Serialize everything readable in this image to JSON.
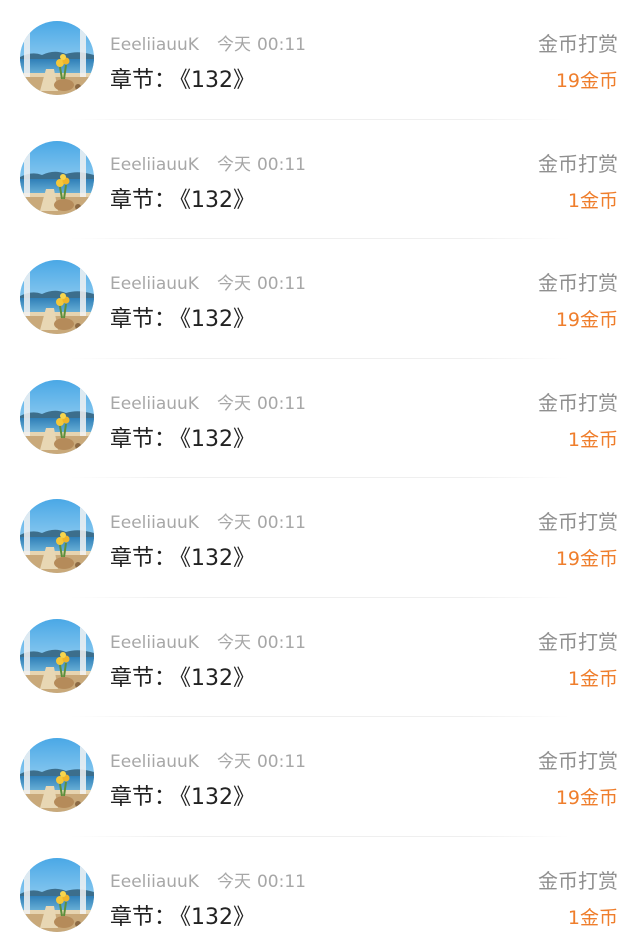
{
  "rewards": [
    {
      "user": "EeeliiauuK",
      "day": "今天",
      "time": "00:11",
      "chapter_label": "章节：",
      "chapter_title": "《132》",
      "reward_label": "金币打赏",
      "amount": "19金币"
    },
    {
      "user": "EeeliiauuK",
      "day": "今天",
      "time": "00:11",
      "chapter_label": "章节：",
      "chapter_title": "《132》",
      "reward_label": "金币打赏",
      "amount": "1金币"
    },
    {
      "user": "EeeliiauuK",
      "day": "今天",
      "time": "00:11",
      "chapter_label": "章节：",
      "chapter_title": "《132》",
      "reward_label": "金币打赏",
      "amount": "19金币"
    },
    {
      "user": "EeeliiauuK",
      "day": "今天",
      "time": "00:11",
      "chapter_label": "章节：",
      "chapter_title": "《132》",
      "reward_label": "金币打赏",
      "amount": "1金币"
    },
    {
      "user": "EeeliiauuK",
      "day": "今天",
      "time": "00:11",
      "chapter_label": "章节：",
      "chapter_title": "《132》",
      "reward_label": "金币打赏",
      "amount": "19金币"
    },
    {
      "user": "EeeliiauuK",
      "day": "今天",
      "time": "00:11",
      "chapter_label": "章节：",
      "chapter_title": "《132》",
      "reward_label": "金币打赏",
      "amount": "1金币"
    },
    {
      "user": "EeeliiauuK",
      "day": "今天",
      "time": "00:11",
      "chapter_label": "章节：",
      "chapter_title": "《132》",
      "reward_label": "金币打赏",
      "amount": "19金币"
    },
    {
      "user": "EeeliiauuK",
      "day": "今天",
      "time": "00:11",
      "chapter_label": "章节：",
      "chapter_title": "《132》",
      "reward_label": "金币打赏",
      "amount": "1金币"
    }
  ],
  "avatar_icon": "seaside-window-avatar",
  "colors": {
    "amount": "#ef7e2c",
    "meta": "#a7a7a7",
    "chapter": "#222222",
    "reward_label": "#8f8f8f"
  }
}
